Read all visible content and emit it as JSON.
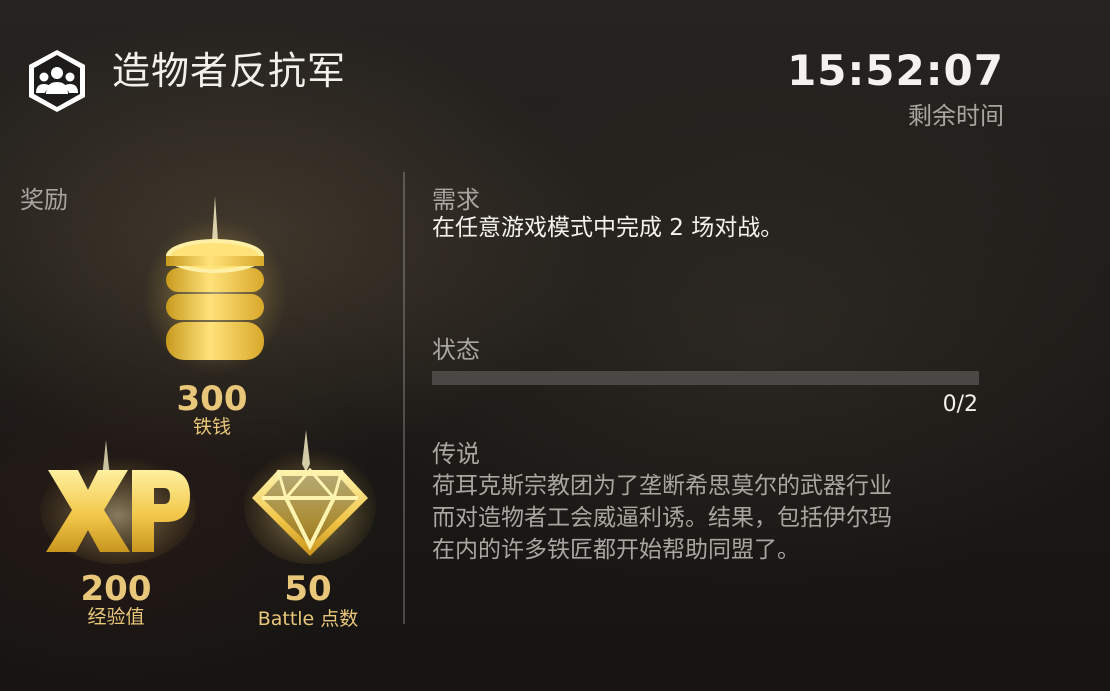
{
  "header": {
    "title": "造物者反抗军",
    "icon": "faction-group-icon",
    "timer": "15:52:07",
    "timer_label": "剩余时间"
  },
  "rewards": {
    "title": "奖励",
    "items": [
      {
        "icon": "coin-stack-icon",
        "amount": "300",
        "label": "铁钱"
      },
      {
        "icon": "xp-icon",
        "amount": "200",
        "label": "经验值"
      },
      {
        "icon": "diamond-icon",
        "amount": "50",
        "label": "Battle 点数"
      }
    ]
  },
  "requirement": {
    "title": "需求",
    "text": "在任意游戏模式中完成 2 场对战。"
  },
  "status": {
    "title": "状态",
    "progress": 0,
    "count": "0/2"
  },
  "lore": {
    "title": "传说",
    "lines": [
      "荷耳克斯宗教团为了垄断希思莫尔的武器行业",
      "而对造物者工会威逼利诱。结果，包括伊尔玛",
      "在内的许多铁匠都开始帮助同盟了。"
    ]
  },
  "colors": {
    "gold": "#e9c77a",
    "muted": "#a9a5a0",
    "text": "#f4f2ee"
  }
}
